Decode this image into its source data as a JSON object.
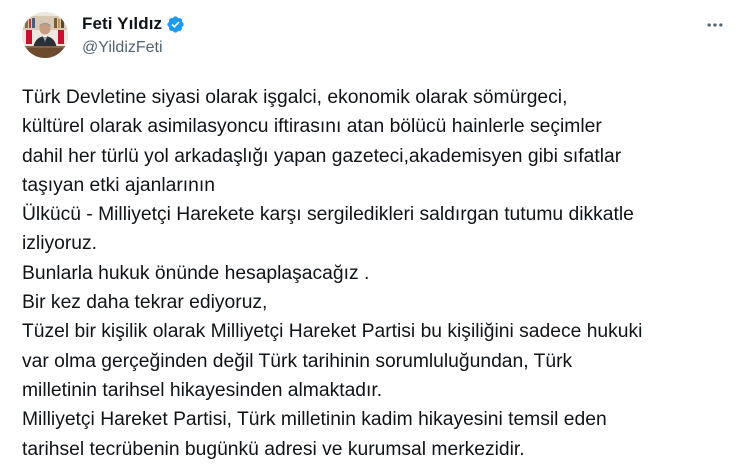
{
  "author": {
    "display_name": "Feti Yıldız",
    "handle": "@YildizFeti",
    "verified": true,
    "verified_color": "#1d9bf0"
  },
  "icons": {
    "verified": "verified-badge-icon",
    "more": "more-options-icon"
  },
  "tweet": {
    "lines": [
      "Türk Devletine siyasi olarak işgalci, ekonomik olarak sömürgeci,",
      "kültürel olarak asimilasyoncu iftirasını atan bölücü hainlerle seçimler",
      "dahil her türlü yol arkadaşlığı yapan gazeteci,akademisyen gibi sıfatlar",
      "taşıyan etki ajanlarının",
      "Ülkücü - Milliyetçi Harekete karşı sergiledikleri saldırgan tutumu dikkatle",
      "izliyoruz.",
      "Bunlarla hukuk önünde hesaplaşacağız .",
      "Bir kez daha tekrar ediyoruz,",
      "Tüzel bir kişilik olarak Milliyetçi Hareket Partisi bu kişiliğini sadece hukuki",
      "var olma gerçeğinden değil Türk tarihinin sorumluluğundan, Türk",
      "milletinin tarihsel hikayesinden almaktadır.",
      "Milliyetçi Hareket Partisi, Türk milletinin kadim hikayesini temsil eden",
      "tarihsel tecrübenin bugünkü adresi ve kurumsal merkezidir."
    ]
  }
}
